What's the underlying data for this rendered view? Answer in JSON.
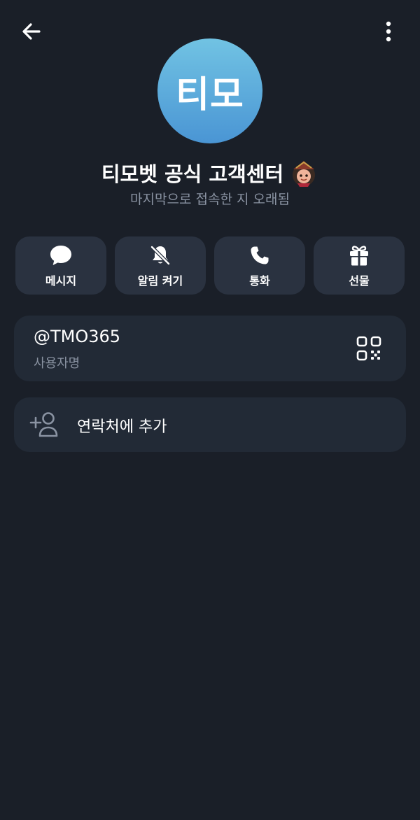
{
  "header": {
    "back_icon": "arrow-left-icon",
    "more_icon": "more-vertical-icon"
  },
  "profile": {
    "avatar_text": "티모",
    "avatar_colors": [
      "#71c3e3",
      "#4a95d4"
    ],
    "name": "티모벳 공식 고객센터",
    "name_emoji": "character-emoji",
    "status": "마지막으로 접속한 지 오래됨"
  },
  "actions": [
    {
      "label": "메시지",
      "icon": "message-bubble-icon"
    },
    {
      "label": "알림 켜기",
      "icon": "bell-off-icon"
    },
    {
      "label": "통화",
      "icon": "phone-icon"
    },
    {
      "label": "선물",
      "icon": "gift-icon"
    }
  ],
  "username": {
    "value": "@TMO365",
    "caption": "사용자명",
    "qr_icon": "qr-code-icon"
  },
  "add_contact": {
    "label": "연락처에 추가",
    "icon": "add-person-icon"
  },
  "colors": {
    "background": "#1a1f28",
    "card": "#222a36",
    "action_button": "#2a3240",
    "secondary_text": "#8a93a2"
  }
}
